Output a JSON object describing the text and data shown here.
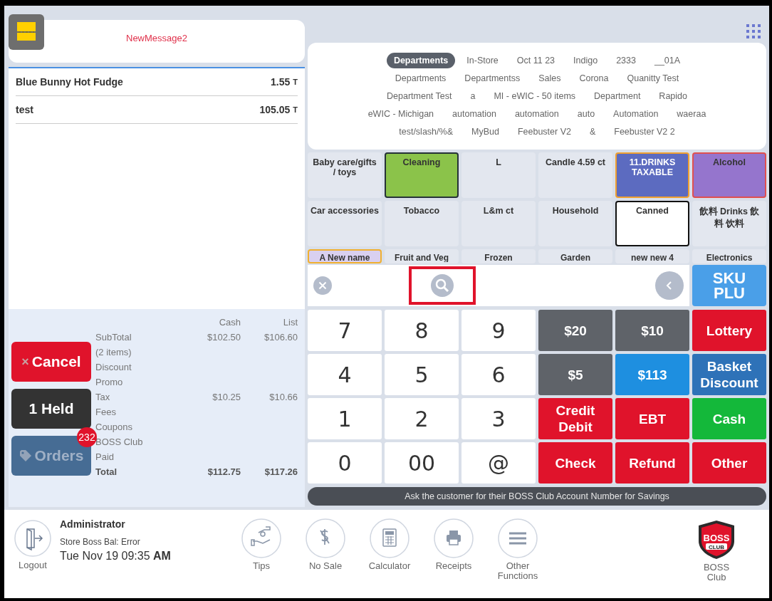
{
  "header": {
    "message": "NewMessage2"
  },
  "order_items": [
    {
      "name": "Blue Bunny Hot Fudge",
      "price": "1.55",
      "tax_flag": "T"
    },
    {
      "name": "test",
      "price": "105.05",
      "tax_flag": "T"
    }
  ],
  "totals": {
    "columns": [
      "Cash",
      "List"
    ],
    "rows": [
      {
        "label": "SubTotal",
        "cash": "$102.50",
        "list": "$106.60",
        "bold": false
      },
      {
        "label": "(2 items)",
        "bold": false
      },
      {
        "label": "Discount",
        "bold": false
      },
      {
        "label": "Promo",
        "bold": false
      },
      {
        "label": "Tax",
        "cash": "$10.25",
        "list": "$10.66",
        "bold": false
      },
      {
        "label": "Fees",
        "bold": false
      },
      {
        "label": "Coupons",
        "bold": false
      },
      {
        "label": "BOSS Club",
        "bold": false
      },
      {
        "label": "Paid",
        "bold": false
      },
      {
        "label": "Total",
        "cash": "$112.75",
        "list": "$117.26",
        "bold": true
      }
    ]
  },
  "side_buttons": [
    {
      "kind": "cancel",
      "icon": "×",
      "label": "Cancel"
    },
    {
      "kind": "held",
      "label": "1 Held"
    },
    {
      "kind": "orders",
      "label": "Orders",
      "badge": "232"
    }
  ],
  "department_tab_rows": [
    [
      {
        "label": "Departments",
        "selected": true
      },
      {
        "label": "In-Store",
        "selected": false
      },
      {
        "label": "Oct 11 23",
        "selected": false
      },
      {
        "label": "Indigo",
        "selected": false
      },
      {
        "label": "2333",
        "selected": false
      },
      {
        "label": "__01A",
        "selected": false
      }
    ],
    [
      {
        "label": "Departments",
        "selected": false
      },
      {
        "label": "Departmentss",
        "selected": false
      },
      {
        "label": "Sales",
        "selected": false
      },
      {
        "label": "Corona",
        "selected": false
      },
      {
        "label": "Quanitty Test",
        "selected": false
      }
    ],
    [
      {
        "label": "Department Test",
        "selected": false
      },
      {
        "label": "a",
        "selected": false
      },
      {
        "label": "MI - eWIC - 50 items",
        "selected": false
      },
      {
        "label": "Department",
        "selected": false
      },
      {
        "label": "Rapido",
        "selected": false
      }
    ],
    [
      {
        "label": "eWIC - Michigan",
        "selected": false
      },
      {
        "label": "automation",
        "selected": false
      },
      {
        "label": "automation",
        "selected": false
      },
      {
        "label": "auto",
        "selected": false
      },
      {
        "label": "Automation",
        "selected": false
      },
      {
        "label": "waeraa",
        "selected": false
      }
    ],
    [
      {
        "label": "test/slash/%&",
        "selected": false
      },
      {
        "label": "MyBud",
        "selected": false
      },
      {
        "label": "Feebuster V2",
        "selected": false
      },
      {
        "label": "&",
        "selected": false
      },
      {
        "label": "Feebuster V2 2",
        "selected": false
      }
    ]
  ],
  "departments": [
    {
      "label": "Baby care/gifts / toys",
      "color": "#e3e7ef"
    },
    {
      "label": "Cleaning",
      "color": "#8bc34a",
      "outline": {
        "color": "#263238"
      }
    },
    {
      "label": "L",
      "color": "#e3e7ef"
    },
    {
      "label": "Candle 4.59 ct",
      "color": "#e3e7ef"
    },
    {
      "label": "11.DRINKS TAXABLE",
      "color": "#5c6bc0",
      "outline": {
        "color": "#f0a030"
      }
    },
    {
      "label": "Alcohol",
      "color": "#9575cd",
      "outline": {
        "color": "#e05050"
      }
    },
    {
      "label": "Car accessories",
      "color": "#e3e7ef"
    },
    {
      "label": "Tobacco",
      "color": "#e3e7ef"
    },
    {
      "label": "L&m ct",
      "color": "#e3e7ef"
    },
    {
      "label": "Household",
      "color": "#e3e7ef"
    },
    {
      "label": "Canned",
      "color": "#ffffff",
      "outline": {
        "color": "#111111"
      }
    },
    {
      "label": "飲料 Drinks 飲料 饮料",
      "color": "#e3e7ef"
    },
    {
      "label": "A New name",
      "color": "#d9d0f0",
      "outline": {
        "color": "#f0b030"
      }
    },
    {
      "label": "Fruit and Veg",
      "color": "#e3e7ef"
    },
    {
      "label": "Frozen",
      "color": "#e3e7ef"
    },
    {
      "label": "Garden",
      "color": "#e3e7ef"
    },
    {
      "label": "new new 4",
      "color": "#e3e7ef"
    },
    {
      "label": "Electronics",
      "color": "#e3e7ef"
    }
  ],
  "sku_button": "SKU PLU",
  "keypad": [
    {
      "label": "7",
      "kind": "digit"
    },
    {
      "label": "8",
      "kind": "digit"
    },
    {
      "label": "9",
      "kind": "digit"
    },
    {
      "label": "$20",
      "kind": "action",
      "color": "#5f6369"
    },
    {
      "label": "$10",
      "kind": "action",
      "color": "#5f6369"
    },
    {
      "label": "Lottery",
      "kind": "action",
      "color": "#e0132b"
    },
    {
      "label": "4",
      "kind": "digit"
    },
    {
      "label": "5",
      "kind": "digit"
    },
    {
      "label": "6",
      "kind": "digit"
    },
    {
      "label": "$5",
      "kind": "action",
      "color": "#5f6369"
    },
    {
      "label": "$113",
      "kind": "action",
      "color": "#1e8fe0"
    },
    {
      "label": "Basket Discount",
      "kind": "action",
      "color": "#2e72b8"
    },
    {
      "label": "1",
      "kind": "digit"
    },
    {
      "label": "2",
      "kind": "digit"
    },
    {
      "label": "3",
      "kind": "digit"
    },
    {
      "label": "Credit Debit",
      "kind": "action",
      "color": "#e0132b"
    },
    {
      "label": "EBT",
      "kind": "action",
      "color": "#e0132b"
    },
    {
      "label": "Cash",
      "kind": "action",
      "color": "#14b83a"
    },
    {
      "label": "0",
      "kind": "digit"
    },
    {
      "label": "00",
      "kind": "digit"
    },
    {
      "label": "@",
      "kind": "digit"
    },
    {
      "label": "Check",
      "kind": "action",
      "color": "#e0132b"
    },
    {
      "label": "Refund",
      "kind": "action",
      "color": "#e0132b"
    },
    {
      "label": "Other",
      "kind": "action",
      "color": "#e0132b"
    }
  ],
  "message_bar": "Ask the customer for their BOSS Club Account Number for Savings",
  "footer": {
    "logout": "Logout",
    "user": "Administrator",
    "balance": "Store Boss Bal: Error",
    "datetime": "Tue Nov 19 09:35 **AM**",
    "tools": [
      {
        "kind": "tips",
        "label": "Tips"
      },
      {
        "kind": "nosale",
        "label": "No Sale"
      },
      {
        "kind": "calculator",
        "label": "Calculator"
      },
      {
        "kind": "receipts",
        "label": "Receipts"
      },
      {
        "kind": "menu",
        "label": "Other Functions"
      }
    ],
    "logo": {
      "top": "BOSS",
      "bottom": "CLUB"
    },
    "club_label": "BOSS Club"
  }
}
